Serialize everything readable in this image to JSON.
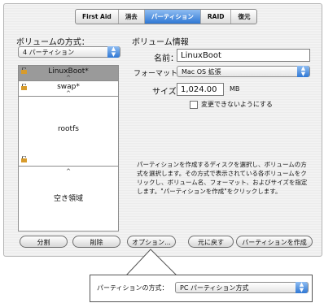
{
  "tabs": [
    {
      "label": "First Aid",
      "active": false
    },
    {
      "label": "消去",
      "active": false
    },
    {
      "label": "パーティション",
      "active": true
    },
    {
      "label": "RAID",
      "active": false
    },
    {
      "label": "復元",
      "active": false
    }
  ],
  "layout": {
    "title": "ボリュームの方式：",
    "scheme": "4 パーティション",
    "partitions": [
      {
        "name": "LinuxBoot*"
      },
      {
        "name": "swap*"
      },
      {
        "name": "rootfs"
      },
      {
        "name": "空き領域"
      }
    ]
  },
  "info": {
    "title": "ボリューム情報",
    "name_label": "名前：",
    "name_value": "LinuxBoot",
    "format_label": "フォーマット：",
    "format_value": "Mac OS 拡張",
    "size_label": "サイズ：",
    "size_value": "1,024.00",
    "size_unit": "MB",
    "lock_label": "変更できないようにする",
    "description": "パーティションを作成するディスクを選択し、ボリュームの方式を選択します。その方式で表示されている各ボリュームをクリックし、ボリューム名、フォーマット、およびサイズを指定します。\"パーティションを作成\"をクリックします。"
  },
  "buttons": {
    "split": "分割",
    "delete": "削除",
    "options": "オプション...",
    "revert": "元に戻す",
    "partition": "パーティションを作成"
  },
  "popup": {
    "label": "パーティションの方式：",
    "value": "PC パーティション方式"
  }
}
